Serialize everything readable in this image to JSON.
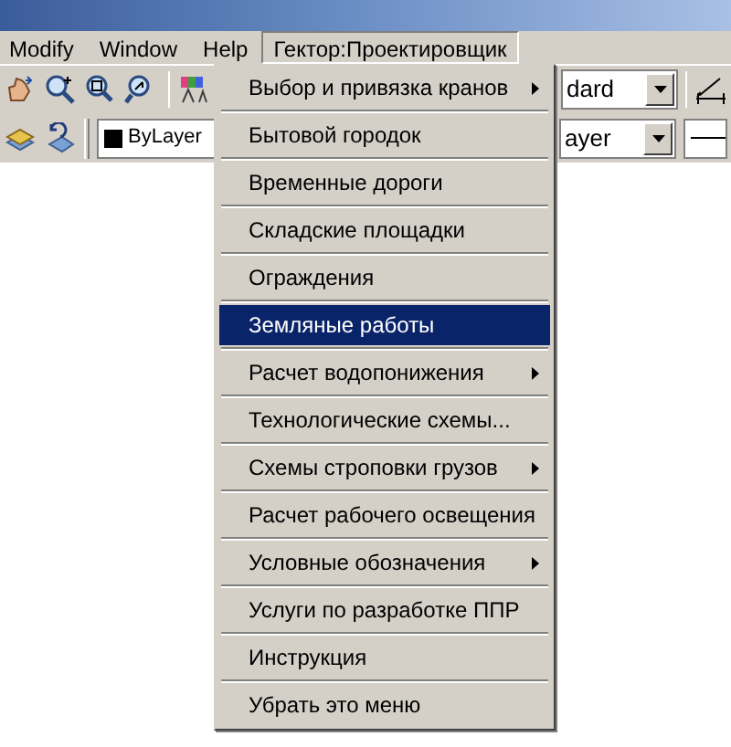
{
  "menu_bar": [
    {
      "label": "Modify",
      "selected": false
    },
    {
      "label": "Window",
      "selected": false
    },
    {
      "label": "Help",
      "selected": false
    },
    {
      "label": "Гектор:Проектировщик",
      "selected": true
    }
  ],
  "toolbar_1": {
    "style_combo": "dard"
  },
  "toolbar_2": {
    "color_combo": "ByLayer",
    "linetype_combo": "ayer"
  },
  "dropdown_menu": [
    {
      "label": "Выбор и привязка кранов",
      "submenu": true,
      "selected": false
    },
    {
      "label": "Бытовой городок",
      "submenu": false,
      "selected": false
    },
    {
      "label": "Временные дороги",
      "submenu": false,
      "selected": false
    },
    {
      "label": "Складские площадки",
      "submenu": false,
      "selected": false
    },
    {
      "label": "Ограждения",
      "submenu": false,
      "selected": false
    },
    {
      "label": "Земляные работы",
      "submenu": false,
      "selected": true
    },
    {
      "label": "Расчет водопонижения",
      "submenu": true,
      "selected": false
    },
    {
      "label": "Технологические схемы...",
      "submenu": false,
      "selected": false
    },
    {
      "label": "Схемы строповки грузов",
      "submenu": true,
      "selected": false
    },
    {
      "label": "Расчет рабочего освещения",
      "submenu": false,
      "selected": false
    },
    {
      "label": "Условные обозначения",
      "submenu": true,
      "selected": false
    },
    {
      "label": "Услуги по разработке ППР",
      "submenu": false,
      "selected": false
    },
    {
      "label": "Инструкция",
      "submenu": false,
      "selected": false
    },
    {
      "label": "Убрать это меню",
      "submenu": false,
      "selected": false
    }
  ]
}
